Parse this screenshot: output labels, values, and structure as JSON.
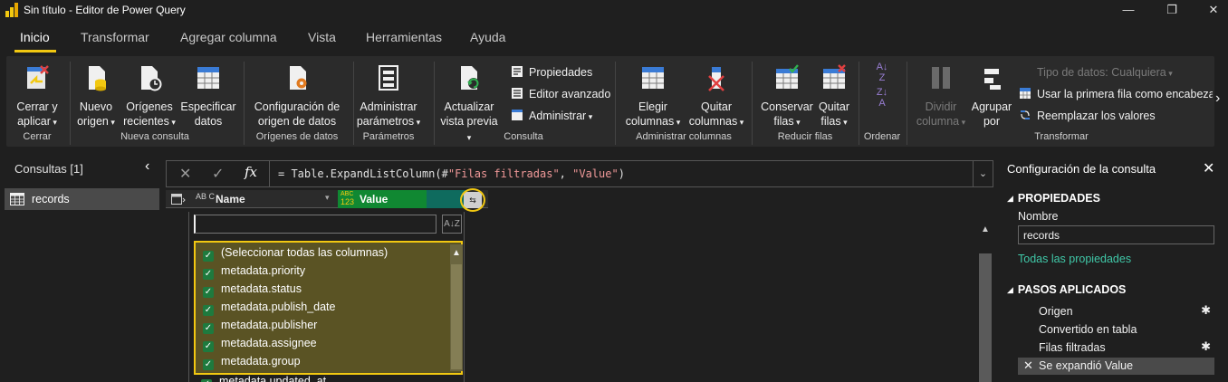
{
  "window": {
    "title": "Sin título - Editor de Power Query",
    "minimize": "—",
    "maximize": "❐",
    "close": "✕"
  },
  "tabs": [
    "Inicio",
    "Transformar",
    "Agregar columna",
    "Vista",
    "Herramientas",
    "Ayuda"
  ],
  "ribbon": {
    "cerrar": {
      "line1": "Cerrar y",
      "line2": "aplicar",
      "group": "Cerrar"
    },
    "nuevo_origen": {
      "line1": "Nuevo",
      "line2": "origen"
    },
    "origenes_recientes": {
      "line1": "Orígenes",
      "line2": "recientes"
    },
    "especificar_datos": {
      "line1": "Especificar",
      "line2": "datos"
    },
    "nueva_consulta_group": "Nueva consulta",
    "config_origen": {
      "line1": "Configuración de",
      "line2": "origen de datos"
    },
    "origenes_group": "Orígenes de datos",
    "admin_param": {
      "line1": "Administrar",
      "line2": "parámetros"
    },
    "parametros_group": "Parámetros",
    "actualizar": {
      "line1": "Actualizar",
      "line2": "vista previa"
    },
    "propiedades": "Propiedades",
    "editor_avanzado": "Editor avanzado",
    "administrar": "Administrar",
    "consulta_group": "Consulta",
    "elegir_columnas": {
      "line1": "Elegir",
      "line2": "columnas"
    },
    "quitar_columnas": {
      "line1": "Quitar",
      "line2": "columnas"
    },
    "admin_col_group": "Administrar columnas",
    "conservar_filas": {
      "line1": "Conservar",
      "line2": "filas"
    },
    "quitar_filas": {
      "line1": "Quitar",
      "line2": "filas"
    },
    "reducir_group": "Reducir filas",
    "ordenar_group": "Ordenar",
    "dividir_columna": {
      "line1": "Dividir",
      "line2": "columna"
    },
    "agrupar_por": {
      "line1": "Agrupar",
      "line2": "por"
    },
    "tipo_datos": "Tipo de datos: Cualquiera",
    "primera_fila": "Usar la primera fila como encabezad",
    "reemplazar": "Reemplazar los valores",
    "transformar_group": "Transformar",
    "more": "›"
  },
  "queries": {
    "header": "Consultas [1]",
    "collapse": "‹",
    "items": [
      "records"
    ]
  },
  "formula": {
    "cancel": "✕",
    "commit": "✓",
    "fx": "fx",
    "prefix": "= Table.ExpandListColumn(#",
    "arg1": "\"Filas filtradas\"",
    "sep": ", ",
    "arg2": "\"Value\"",
    "suffix": ")",
    "expand": "⌄"
  },
  "grid": {
    "col_name_type": "AB C",
    "col_name": "Name",
    "col_value_type_top": "ABC",
    "col_value_type_bottom": "123",
    "col_value": "Value",
    "expand_icon": "⇆",
    "search_value": "",
    "sort_icon": "A↓Z",
    "checklist": [
      "(Seleccionar todas las columnas)",
      "metadata.priority",
      "metadata.status",
      "metadata.publish_date",
      "metadata.publisher",
      "metadata.assignee",
      "metadata.group",
      "metadata.updated_at"
    ]
  },
  "settings": {
    "title": "Configuración de la consulta",
    "close": "✕",
    "props_header": "PROPIEDADES",
    "name_label": "Nombre",
    "name_value": "records",
    "all_props": "Todas las propiedades",
    "steps_header": "PASOS APLICADOS",
    "steps": [
      "Origen",
      "Convertido en tabla",
      "Filas filtradas",
      "Se expandió Value"
    ]
  },
  "colors": {
    "accent": "#f2c811",
    "highlight_fill": "#5a5324",
    "value_header": "#0f6b5e",
    "link": "#40c8a8"
  }
}
